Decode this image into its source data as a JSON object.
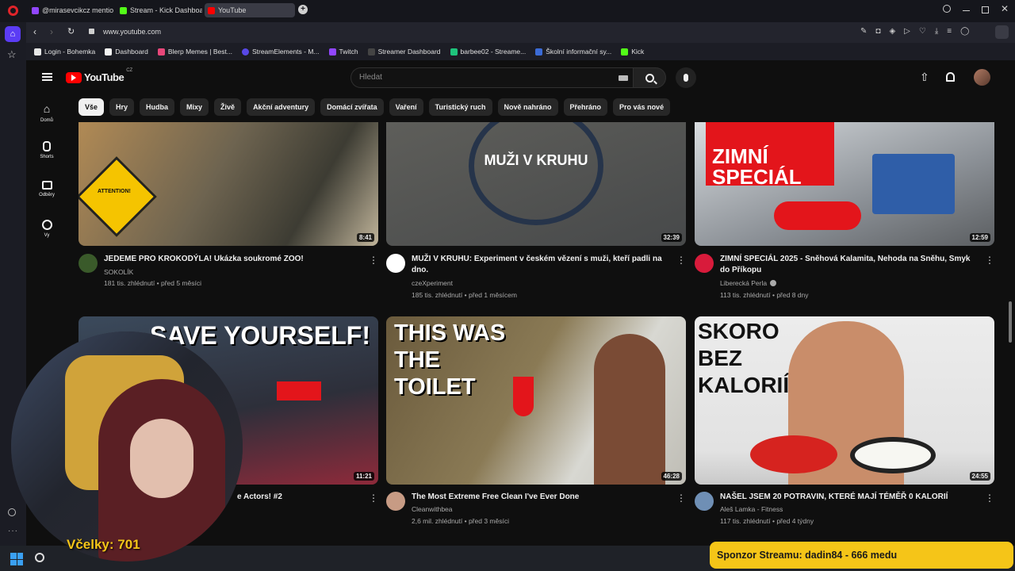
{
  "browser": {
    "tabs": [
      {
        "label": "@mirasevcikcz mentio"
      },
      {
        "label": "Stream - Kick Dashboard"
      },
      {
        "label": "YouTube"
      }
    ],
    "url": "www.youtube.com",
    "bookmarks": [
      {
        "label": "Login - Bohemka"
      },
      {
        "label": "Dashboard"
      },
      {
        "label": "Blerp Memes | Best..."
      },
      {
        "label": "StreamElements - M..."
      },
      {
        "label": "Twitch"
      },
      {
        "label": "Streamer Dashboard"
      },
      {
        "label": "barbee02 - Streame..."
      },
      {
        "label": "Školní informační sy..."
      },
      {
        "label": "Kick"
      }
    ]
  },
  "youtube": {
    "logo_text": "YouTube",
    "region": "CZ",
    "search_placeholder": "Hledat",
    "guide": [
      {
        "label": "Domů",
        "icon": "home-icon"
      },
      {
        "label": "Shorts",
        "icon": "shorts-icon"
      },
      {
        "label": "Odběry",
        "icon": "subscriptions-icon"
      },
      {
        "label": "Vy",
        "icon": "you-icon"
      }
    ],
    "chips": [
      "Vše",
      "Hry",
      "Hudba",
      "Mixy",
      "Živě",
      "Akční adventury",
      "Domácí zvířata",
      "Vaření",
      "Turistický ruch",
      "Nově nahráno",
      "Přehráno",
      "Pro vás nové"
    ],
    "videos": [
      {
        "title": "JEDEME PRO KROKODÝLA! Ukázka soukromé ZOO!",
        "channel": "SOKOLÍK",
        "meta": "181 tis. zhlédnutí • před 5 měsíci",
        "duration": "8:41",
        "thumb_text": "ATTENTION!"
      },
      {
        "title": "MUŽI V KRUHU: Experiment v českém vězení s muži, kteří padli na dno.",
        "channel": "czeXperiment",
        "meta": "185 tis. zhlédnutí • před 1 měsícem",
        "duration": "32:39",
        "thumb_text": "MUŽI V KRUHU"
      },
      {
        "title": "ZIMNÍ SPECIÁL 2025 - Sněhová Kalamita, Nehoda na Sněhu, Smyk do Příkopu",
        "channel": "Liberecká Perla",
        "meta": "113 tis. zhlédnutí • před 8 dny",
        "duration": "12:59",
        "thumb_text": "ZIMNÍ SPECIÁL"
      },
      {
        "title": "e Actors! #2",
        "channel": "",
        "meta": "",
        "duration": "11:21",
        "thumb_text": "SAVE YOURSELF!"
      },
      {
        "title": "The Most Extreme Free Clean I've Ever Done",
        "channel": "Cleanwithbea",
        "meta": "2,6 mil. zhlédnutí • před 3 měsíci",
        "duration": "46:28",
        "thumb_text": "THIS WAS THE TOILET"
      },
      {
        "title": "NAŠEL JSEM 20 POTRAVIN, KTERÉ MAJÍ TÉMĚŘ 0 KALORIÍ",
        "channel": "Aleš Lamka - Fitness",
        "meta": "117 tis. zhlédnutí • před 4 týdny",
        "duration": "24:55",
        "thumb_text": "SKORO BEZ KALORIÍ"
      }
    ]
  },
  "overlay": {
    "bees_label": "Včelky:",
    "bees_count": "701",
    "sponsor_text": "Sponzor Streamu: dadin84 - 666 medu"
  },
  "colors": {
    "accent_red": "#ff0000",
    "sponsor_yellow": "#f5c518"
  }
}
